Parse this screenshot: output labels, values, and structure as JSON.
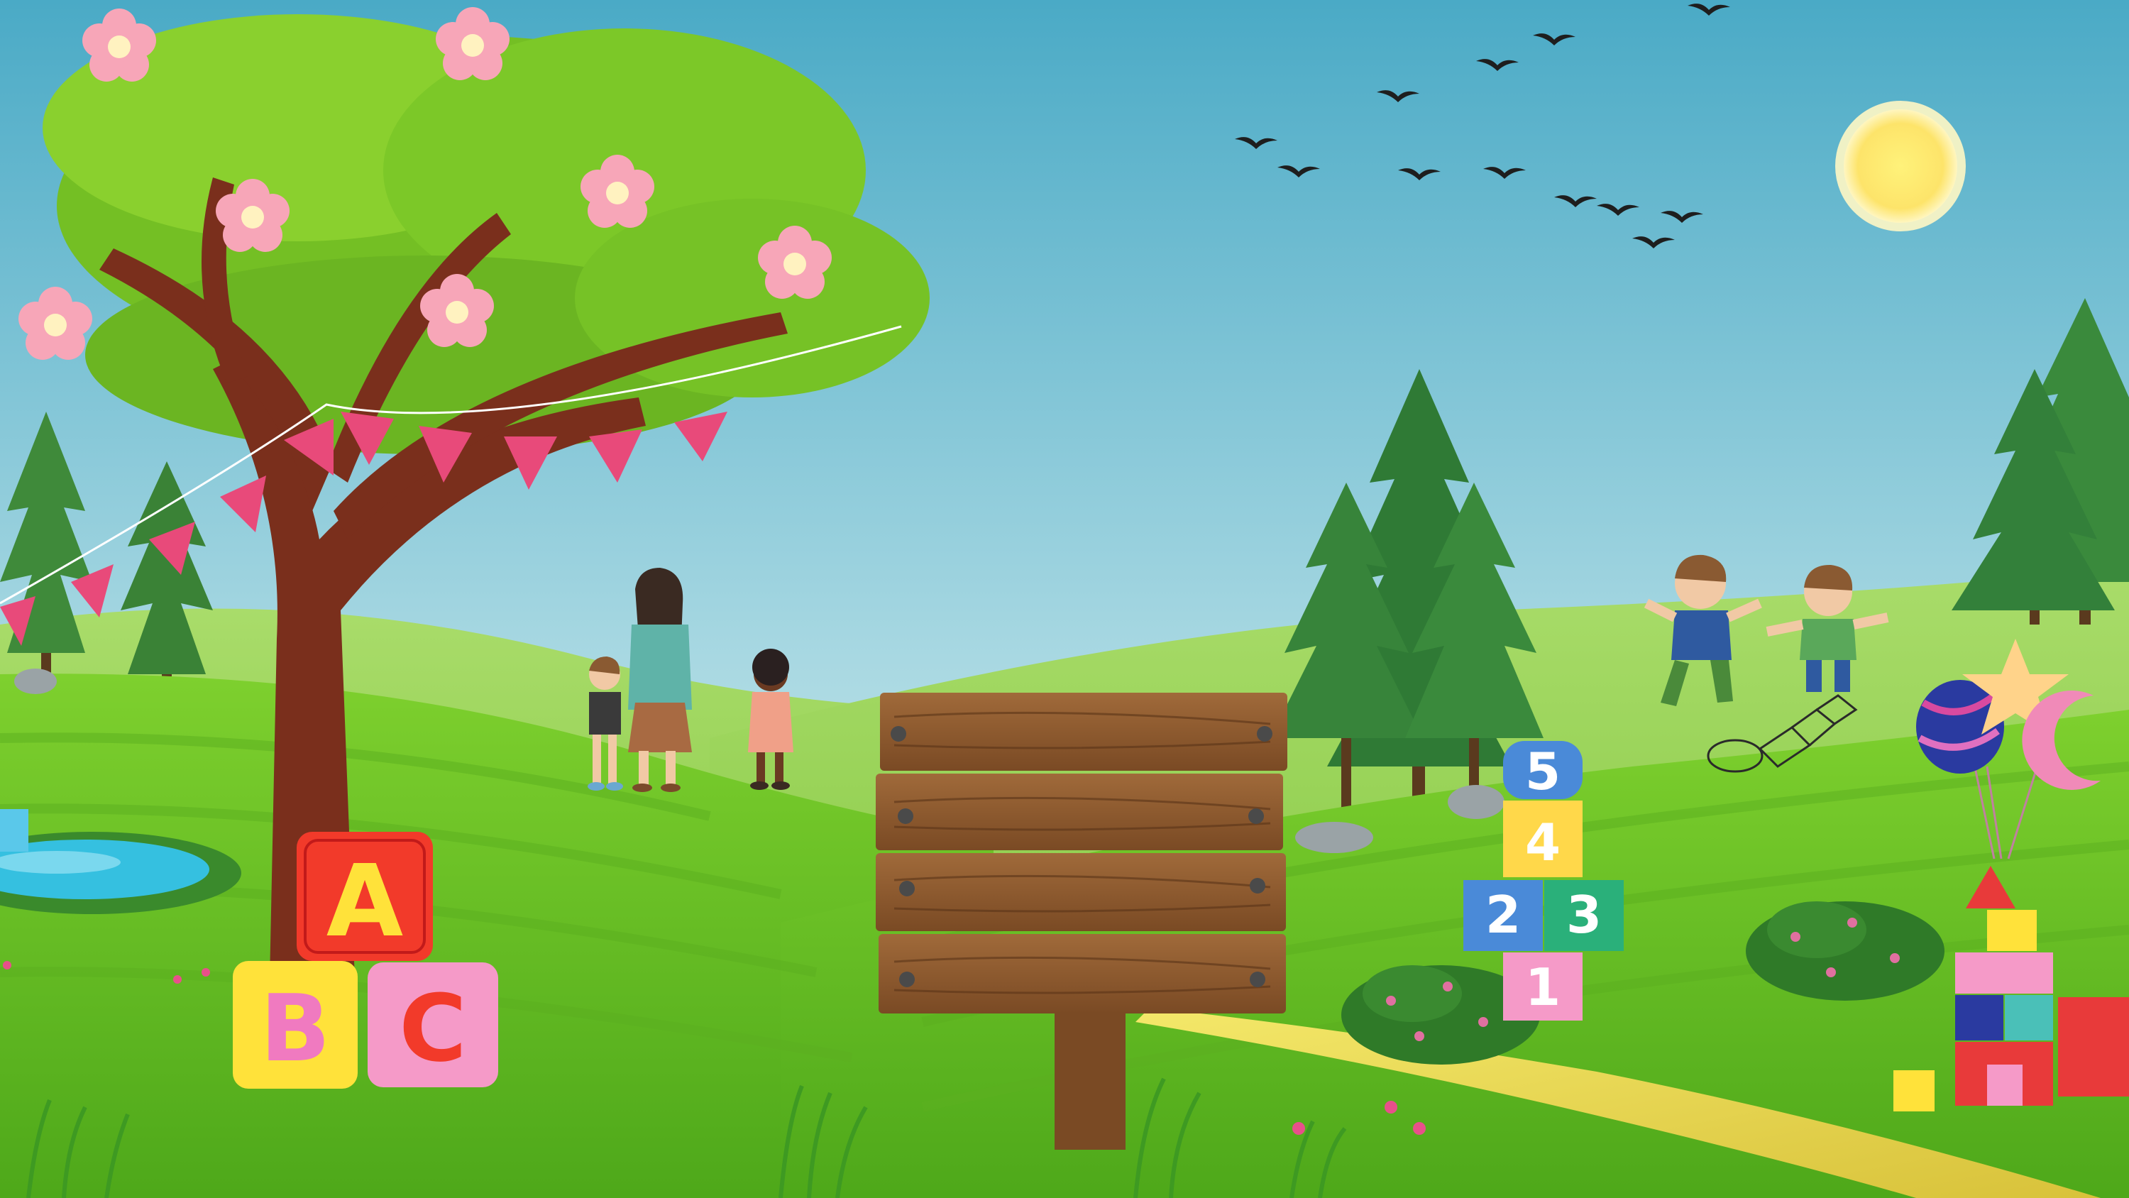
{
  "scene": {
    "description_tags": [
      "meadow",
      "tree",
      "signboard",
      "children",
      "playground"
    ],
    "colors": {
      "sky_top": "#5fb3c8",
      "sky_bottom": "#d8eef0",
      "grass_light": "#8fd43a",
      "grass_dark": "#4caf1f",
      "path": "#e8d84a",
      "wood": "#8a5a32",
      "trunk": "#7a2f1c",
      "leaves": "#7cc42a",
      "flower": "#f7a6b8",
      "bunting": "#e84a7a",
      "sun": "#ffe97a",
      "water": "#3ec3e0"
    }
  },
  "alphabet_blocks": [
    {
      "letter": "A",
      "face": "#f23a2a",
      "text": "#ffe23a"
    },
    {
      "letter": "B",
      "face": "#ffe23a",
      "text": "#f07ac0"
    },
    {
      "letter": "C",
      "face": "#f59ac8",
      "text": "#f23a2a"
    }
  ],
  "hopscotch_tiles": [
    {
      "label": "5",
      "color": "#4a8ad8"
    },
    {
      "label": "4",
      "color": "#ffd84a"
    },
    {
      "label": "2",
      "color": "#4a8ad8"
    },
    {
      "label": "3",
      "color": "#2ab07a"
    },
    {
      "label": "1",
      "color": "#f59ac8"
    }
  ],
  "signboard": {
    "planks": 4,
    "text": ""
  }
}
